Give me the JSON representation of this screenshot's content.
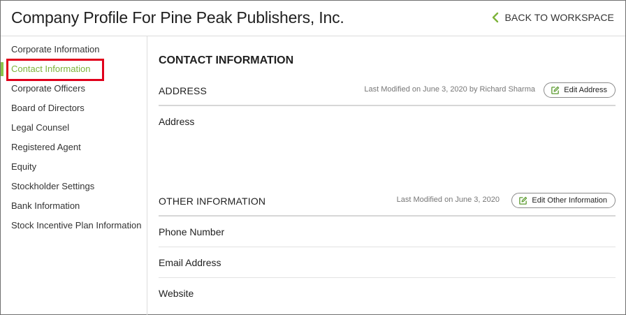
{
  "header": {
    "title": "Company Profile For Pine Peak Publishers, Inc.",
    "back_label": "BACK TO WORKSPACE",
    "back_icon": "chevron-left-icon",
    "accent_color": "#7db33a"
  },
  "sidebar": {
    "items": [
      {
        "label": "Corporate Information"
      },
      {
        "label": "Contact Information"
      },
      {
        "label": "Corporate Officers"
      },
      {
        "label": "Board of Directors"
      },
      {
        "label": "Legal Counsel"
      },
      {
        "label": "Registered Agent"
      },
      {
        "label": "Equity"
      },
      {
        "label": "Stockholder Settings"
      },
      {
        "label": "Bank Information"
      },
      {
        "label": "Stock Incentive Plan Information"
      }
    ],
    "active_item": "Contact Information",
    "highlight_color": "#e0001b"
  },
  "main": {
    "section_title": "CONTACT INFORMATION",
    "address": {
      "heading": "ADDRESS",
      "last_modified": "Last Modified on June 3, 2020 by Richard Sharma",
      "edit_label": "Edit Address",
      "edit_icon": "edit-icon",
      "fields": [
        "Address"
      ]
    },
    "other": {
      "heading": "OTHER INFORMATION",
      "last_modified": "Last Modified on June 3, 2020",
      "edit_label": "Edit Other Information",
      "edit_icon": "edit-icon",
      "fields": [
        "Phone Number",
        "Email Address",
        "Website"
      ]
    }
  }
}
